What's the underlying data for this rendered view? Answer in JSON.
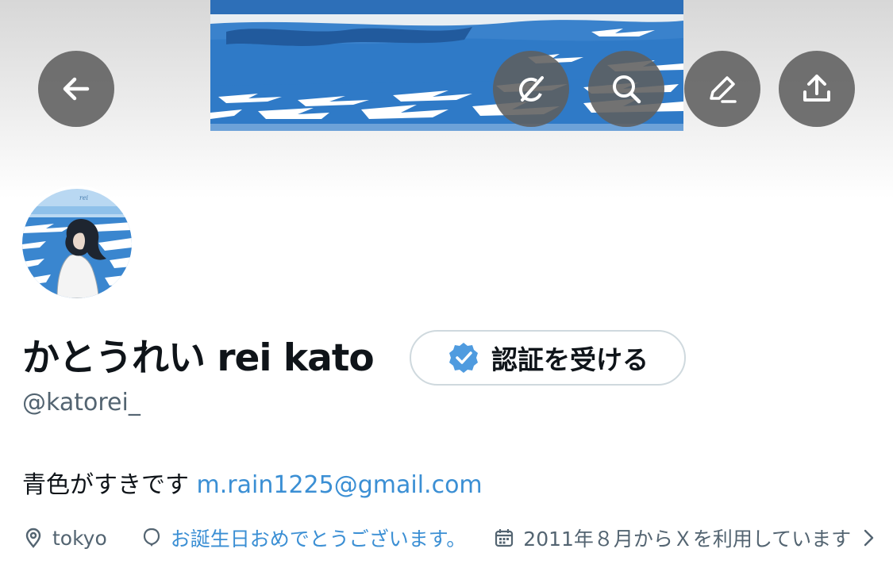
{
  "profile": {
    "display_name": "かとうれい rei kato",
    "handle": "@katorei_",
    "bio_text": "青色がすきです",
    "bio_link": "m.rain1225@gmail.com",
    "location": "tokyo",
    "birthday_text": "お誕生日おめでとうございます。",
    "joined_text": "2011年８月からＸを利用しています"
  },
  "buttons": {
    "verify_label": "認証を受ける"
  },
  "header": {
    "icons": [
      "back-arrow-icon",
      "grok-icon",
      "search-icon",
      "edit-pencil-icon",
      "share-icon"
    ]
  },
  "colors": {
    "link_blue": "#3b8fd4",
    "verified_blue": "#4f9bdf",
    "ocean_blue": "#2e78c7",
    "icon_button_gray": "#5f5f5f"
  }
}
